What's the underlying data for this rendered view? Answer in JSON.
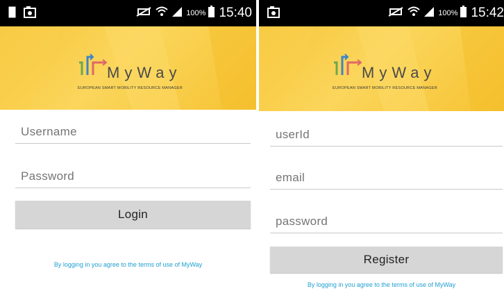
{
  "login_screen": {
    "status_bar": {
      "battery_percent": "100%",
      "time": "15:40"
    },
    "brand": {
      "name": "MyWay",
      "tagline": "EUROPEAN SMART MOBILITY RESOURCE MANAGER"
    },
    "form": {
      "username_placeholder": "Username",
      "password_placeholder": "Password",
      "login_label": "Login"
    },
    "terms_text": "By logging in you agree to the terms of use of MyWay"
  },
  "register_screen": {
    "status_bar": {
      "battery_percent": "100%",
      "time": "15:42"
    },
    "brand": {
      "name": "MyWay",
      "tagline": "EUROPEAN SMART MOBILITY RESOURCE MANAGER"
    },
    "form": {
      "userid_placeholder": "userId",
      "email_placeholder": "email",
      "password_placeholder": "password",
      "register_label": "Register"
    },
    "terms_text": "By logging in you agree to the terms of use of MyWay"
  },
  "colors": {
    "banner": "#f7c53a",
    "link": "#1f9fd1",
    "button": "#d6d6d6",
    "status_bar": "#000000"
  },
  "icons": [
    "sim-card-icon",
    "photo-notification-icon",
    "mute-icon",
    "wifi-icon",
    "signal-icon",
    "battery-icon",
    "myway-logo-icon"
  ]
}
